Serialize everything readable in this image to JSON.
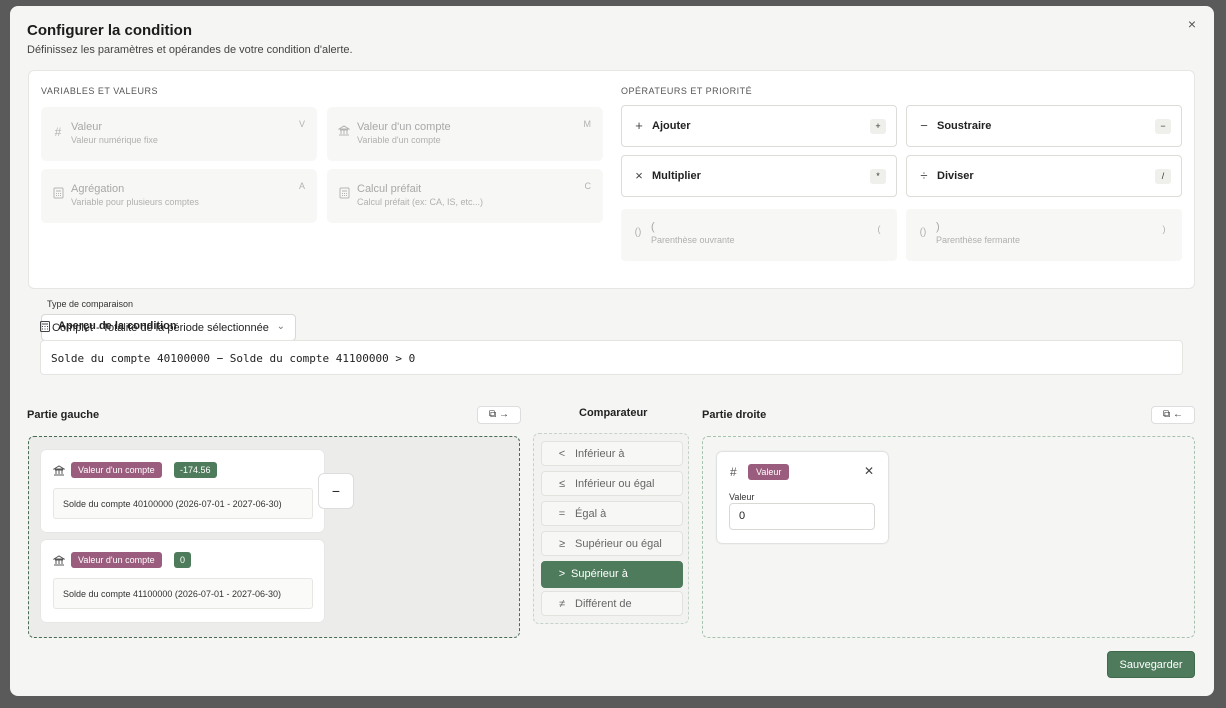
{
  "modal": {
    "title": "Configurer la condition",
    "subtitle": "Définissez les paramètres et opérandes de votre condition d'alerte.",
    "close": "×"
  },
  "variables": {
    "heading": "VARIABLES ET VALEURS",
    "items": [
      {
        "icon": "hash-icon",
        "title": "Valeur",
        "subtitle": "Valeur numérique fixe",
        "key": "V"
      },
      {
        "icon": "bank-icon",
        "title": "Valeur d'un compte",
        "subtitle": "Variable d'un compte",
        "key": "M"
      },
      {
        "icon": "calculator-icon",
        "title": "Agrégation",
        "subtitle": "Variable pour plusieurs comptes",
        "key": "A"
      },
      {
        "icon": "calculator-icon",
        "title": "Calcul préfait",
        "subtitle": "Calcul préfait (ex: CA, IS, etc...)",
        "key": "C"
      }
    ],
    "comparison_label": "Type de comparaison",
    "comparison_value": "Complet - Totalité de la période sélectionnée"
  },
  "operators": {
    "heading": "OPÉRATEURS ET PRIORITÉ",
    "items": [
      {
        "symbol": "+",
        "title": "Ajouter",
        "key": "+"
      },
      {
        "symbol": "−",
        "title": "Soustraire",
        "key": "−"
      },
      {
        "symbol": "×",
        "title": "Multiplier",
        "key": "*"
      },
      {
        "symbol": "÷",
        "title": "Diviser",
        "key": "/"
      },
      {
        "symbol": "()",
        "title": "(",
        "subtitle": "Parenthèse ouvrante",
        "key": "("
      },
      {
        "symbol": "()",
        "title": ")",
        "subtitle": "Parenthèse fermante",
        "key": ")"
      }
    ]
  },
  "preview": {
    "title": "Aperçu de la condition",
    "text": "Solde du compte 40100000 − Solde du compte 41100000 > 0"
  },
  "left": {
    "title": "Partie gauche",
    "terms": [
      {
        "tag": "Valeur d'un compte",
        "value": "-174.56",
        "account": "Solde du compte 40100000 (2026-07-01 - 2027-06-30)"
      },
      {
        "tag": "Valeur d'un compte",
        "value": "0",
        "account": "Solde du compte 41100000 (2026-07-01 - 2027-06-30)"
      }
    ],
    "operator": "−"
  },
  "comparator": {
    "title": "Comparateur",
    "items": [
      {
        "symbol": "<",
        "label": "Inférieur à"
      },
      {
        "symbol": "≤",
        "label": "Inférieur ou égal"
      },
      {
        "symbol": "=",
        "label": "Égal à"
      },
      {
        "symbol": "≥",
        "label": "Supérieur ou égal"
      },
      {
        "symbol": ">",
        "label": "Supérieur à",
        "active": true
      },
      {
        "symbol": "≠",
        "label": "Différent de"
      }
    ]
  },
  "right": {
    "title": "Partie droite",
    "term": {
      "tag": "Valeur",
      "field_label": "Valeur",
      "field_value": "0"
    }
  },
  "save_label": "Sauvegarder"
}
